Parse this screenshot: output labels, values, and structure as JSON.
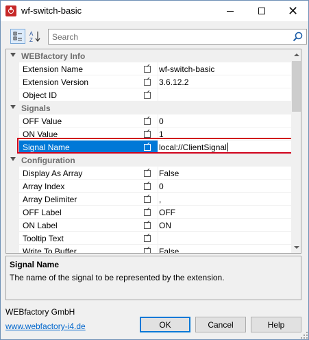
{
  "window": {
    "title": "wf-switch-basic",
    "minimize_glyph": "",
    "close_glyph": "✕"
  },
  "toolbar": {
    "search_placeholder": "Search",
    "search_value": ""
  },
  "grid": {
    "categories": [
      {
        "label": "WEBfactory Info",
        "properties": [
          {
            "name": "Extension Name",
            "value": "wf-switch-basic"
          },
          {
            "name": "Extension Version",
            "value": "3.6.12.2"
          },
          {
            "name": "Object ID",
            "value": ""
          }
        ]
      },
      {
        "label": "Signals",
        "properties": [
          {
            "name": "OFF Value",
            "value": "0"
          },
          {
            "name": "ON Value",
            "value": "1"
          },
          {
            "name": "Signal Name",
            "value": "local://ClientSignal"
          }
        ]
      },
      {
        "label": "Configuration",
        "properties": [
          {
            "name": "Display As Array",
            "value": "False"
          },
          {
            "name": "Array Index",
            "value": "0"
          },
          {
            "name": "Array Delimiter",
            "value": ","
          },
          {
            "name": "OFF Label",
            "value": "OFF"
          },
          {
            "name": "ON Label",
            "value": "ON"
          },
          {
            "name": "Tooltip Text",
            "value": ""
          },
          {
            "name": "Write To Buffer",
            "value": "False"
          }
        ]
      }
    ],
    "selected_property": "Signal Name"
  },
  "description": {
    "title": "Signal Name",
    "text": "The name of the signal to be represented by the extension."
  },
  "footer": {
    "company": "WEBfactory GmbH",
    "link": "www.webfactory-i4.de",
    "ok_label": "OK",
    "cancel_label": "Cancel",
    "help_label": "Help"
  },
  "colors": {
    "selection": "#0078d7",
    "highlight_border": "#d0021b",
    "link": "#0066cc",
    "category_text": "#6d6d6d"
  }
}
